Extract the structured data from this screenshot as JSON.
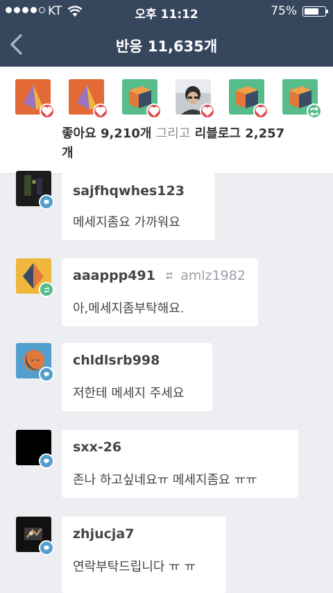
{
  "status_bar": {
    "carrier": "KT",
    "time": "오후 11:12",
    "battery": "75%",
    "battery_level": 0.75
  },
  "header": {
    "title": "반응 11,635개"
  },
  "summary": {
    "likes": "좋아요 9,210개",
    "conjunction": "그리고",
    "reblogs": "리블로그 2,257",
    "unit": "개"
  },
  "notes": [
    {
      "username": "sajfhqwhes123",
      "message": "메세지좀요 가까워요",
      "type": "reply"
    },
    {
      "username": "aaappp491",
      "via": "amlz1982",
      "message": "아,메세지좀부탁해요.",
      "type": "reblog"
    },
    {
      "username": "chldlsrb998",
      "message": "저한테 메세지 주세요",
      "type": "reply"
    },
    {
      "username": "sxx-26",
      "message": "존나 하고싶네요ㅠ 메세지좀요 ㅠㅠ",
      "type": "reply"
    },
    {
      "username": "zhjucja7",
      "message": "연락부탁드립니다 ㅠ ㅠ",
      "type": "reply"
    }
  ],
  "colors": {
    "header_bg": "#36465d",
    "like": "#de4c4c",
    "reblog": "#56bc8a",
    "reply": "#529ecc"
  }
}
